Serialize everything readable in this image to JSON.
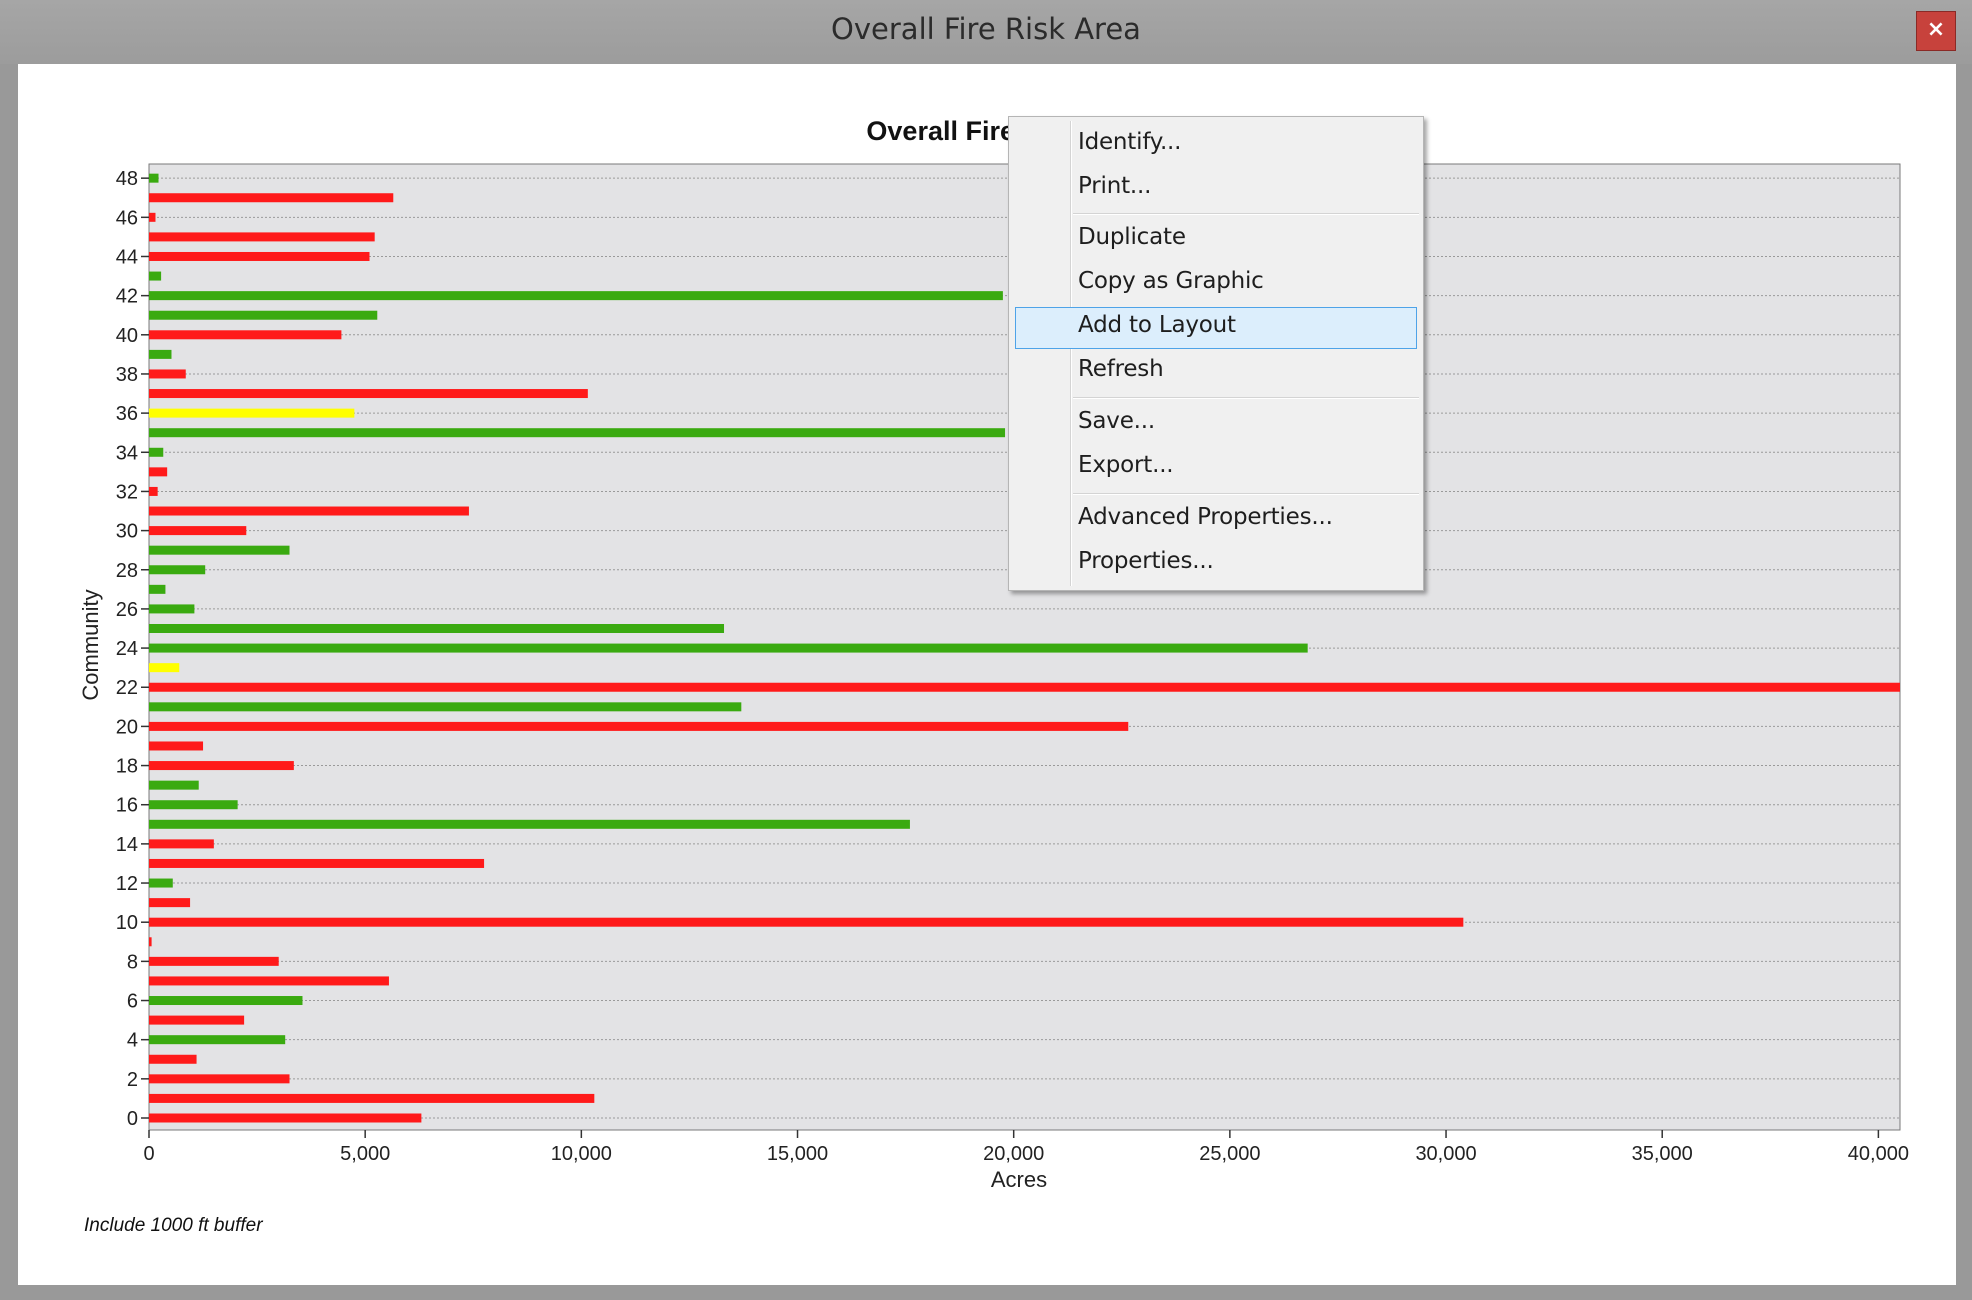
{
  "window": {
    "title": "Overall Fire Risk Area",
    "close_label": "×"
  },
  "colors": {
    "red": "#ff1a1a",
    "green": "#3aaa10",
    "yellow": "#ffff00",
    "plot_bg": "#e3e3e5",
    "menu_highlight": "#dceefc"
  },
  "chart_data": {
    "type": "bar",
    "orientation": "horizontal",
    "title": "Overall Fire",
    "xlabel": "Acres",
    "ylabel": "Community",
    "footnote": "Include 1000 ft buffer",
    "xlim": [
      0,
      40500
    ],
    "x_ticks": [
      0,
      5000,
      10000,
      15000,
      20000,
      25000,
      30000,
      35000,
      40000
    ],
    "x_tick_labels": [
      "0",
      "5,000",
      "10,000",
      "15,000",
      "20,000",
      "25,000",
      "30,000",
      "35,000",
      "40,000"
    ],
    "y_tick_labels": [
      "0",
      "2",
      "4",
      "6",
      "8",
      "10",
      "12",
      "14",
      "16",
      "18",
      "20",
      "22",
      "24",
      "26",
      "28",
      "30",
      "32",
      "34",
      "36",
      "38",
      "40",
      "42",
      "44",
      "46",
      "48"
    ],
    "grid": true,
    "categories": [
      0,
      1,
      2,
      3,
      4,
      5,
      6,
      7,
      8,
      9,
      10,
      11,
      12,
      13,
      14,
      15,
      16,
      17,
      18,
      19,
      20,
      21,
      22,
      23,
      24,
      25,
      26,
      27,
      28,
      29,
      30,
      31,
      32,
      33,
      34,
      35,
      36,
      37,
      38,
      39,
      40,
      41,
      42,
      43,
      44,
      45,
      46,
      47,
      48
    ],
    "values": [
      6300,
      10300,
      3250,
      1100,
      3150,
      2200,
      3550,
      5550,
      3000,
      60,
      30400,
      950,
      550,
      7750,
      1500,
      17600,
      2050,
      1150,
      3350,
      1250,
      22650,
      13700,
      40500,
      700,
      26800,
      13300,
      1050,
      380,
      1300,
      3250,
      2250,
      7400,
      200,
      420,
      330,
      19800,
      4750,
      10150,
      850,
      520,
      4450,
      5280,
      19750,
      280,
      5100,
      5220,
      150,
      5650,
      220
    ],
    "bar_colors": [
      "red",
      "red",
      "red",
      "red",
      "green",
      "red",
      "green",
      "red",
      "red",
      "red",
      "red",
      "red",
      "green",
      "red",
      "red",
      "green",
      "green",
      "green",
      "red",
      "red",
      "red",
      "green",
      "red",
      "yellow",
      "green",
      "green",
      "green",
      "green",
      "green",
      "green",
      "red",
      "red",
      "red",
      "red",
      "green",
      "green",
      "yellow",
      "red",
      "red",
      "green",
      "red",
      "green",
      "green",
      "green",
      "red",
      "red",
      "red",
      "red",
      "green"
    ]
  },
  "context_menu": {
    "items": [
      {
        "label": "Identify..."
      },
      {
        "label": "Print..."
      },
      {
        "label": "Duplicate"
      },
      {
        "label": "Copy as Graphic"
      },
      {
        "label": "Add to Layout",
        "highlighted": true
      },
      {
        "label": "Refresh"
      },
      {
        "label": "Save..."
      },
      {
        "label": "Export..."
      },
      {
        "label": "Advanced Properties..."
      },
      {
        "label": "Properties..."
      }
    ]
  }
}
